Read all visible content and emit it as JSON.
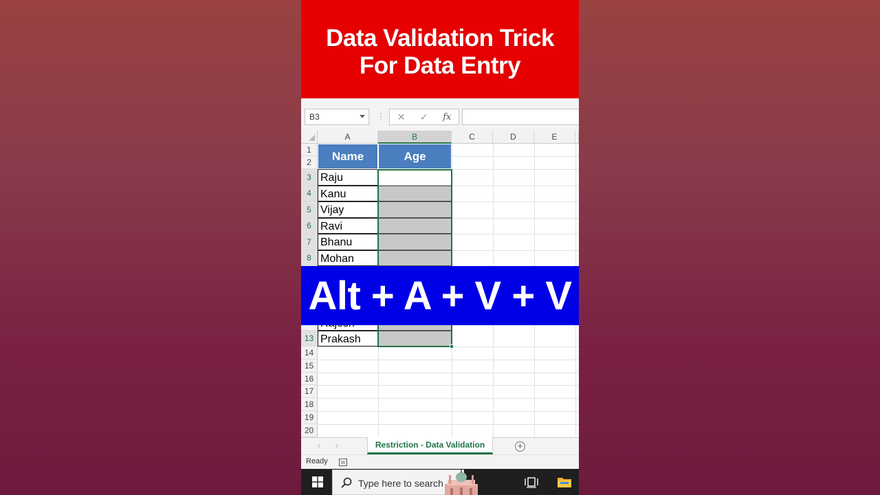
{
  "title": {
    "line1": "Data Validation Trick",
    "line2": "For Data Entry"
  },
  "formula_bar": {
    "name_box": "B3",
    "cancel_glyph": "✕",
    "enter_glyph": "✓",
    "fx_label": "fx",
    "formula_value": ""
  },
  "columns": [
    "A",
    "B",
    "C",
    "D",
    "E"
  ],
  "selected_column": "B",
  "rows": [
    "1",
    "2",
    "3",
    "4",
    "5",
    "6",
    "7",
    "8",
    "13",
    "14",
    "15",
    "16",
    "17",
    "18",
    "19",
    "20"
  ],
  "table": {
    "headers": {
      "name": "Name",
      "age": "Age"
    },
    "names": {
      "r3": "Raju",
      "r4": "Kanu",
      "r5": "Vijay",
      "r6": "Ravi",
      "r7": "Bhanu",
      "r8": "Mohan",
      "r12_partial": "Rajesh",
      "r13": "Prakash"
    }
  },
  "shortcut_banner": "Alt + A + V + V",
  "sheet_tab": "Restriction - Data Validation",
  "status": "Ready",
  "taskbar": {
    "search_placeholder": "Type here to search"
  },
  "colors": {
    "title_banner": "#e60000",
    "shortcut_banner": "#0000e6",
    "table_header": "#4a7ebf",
    "excel_green": "#217346",
    "locked_cell": "#c8c8c8"
  },
  "icons": [
    "windows-start-icon",
    "search-icon",
    "task-view-icon",
    "file-explorer-icon",
    "add-sheet-icon",
    "macro-record-icon"
  ]
}
